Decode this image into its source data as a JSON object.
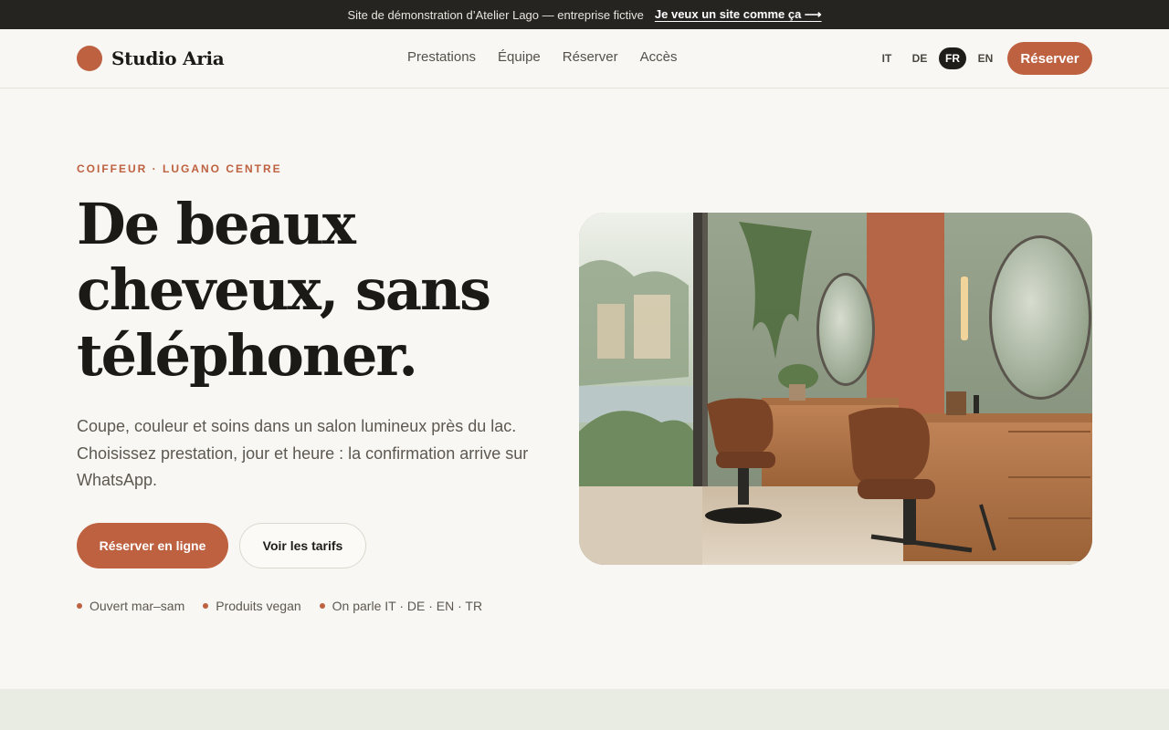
{
  "demo_bar": {
    "text": "Site de démonstration d’Atelier Lago — entreprise fictive",
    "link": "Je veux un site comme ça ⟶"
  },
  "header": {
    "brand": "Studio Aria",
    "nav": [
      "Prestations",
      "Équipe",
      "Réserver",
      "Accès"
    ],
    "languages": [
      "IT",
      "DE",
      "FR",
      "EN"
    ],
    "active_language": "FR",
    "cta": "Réserver"
  },
  "hero": {
    "eyebrow": "COIFFEUR · LUGANO CENTRE",
    "title_lines": [
      "De beaux",
      "cheveux, sans",
      "téléphoner."
    ],
    "description": "Coupe, couleur et soins dans un salon lumineux près du lac. Choisissez prestation, jour et heure : la confirmation arrive sur WhatsApp.",
    "primary_cta": "Réserver en ligne",
    "secondary_cta": "Voir les tarifs",
    "features": [
      "Ouvert mar–sam",
      "Produits vegan",
      "On parle IT · DE · EN · TR"
    ]
  },
  "colors": {
    "accent": "#bd6140",
    "dark": "#262421",
    "background": "#f9f7f3",
    "band": "#e9ece3"
  }
}
